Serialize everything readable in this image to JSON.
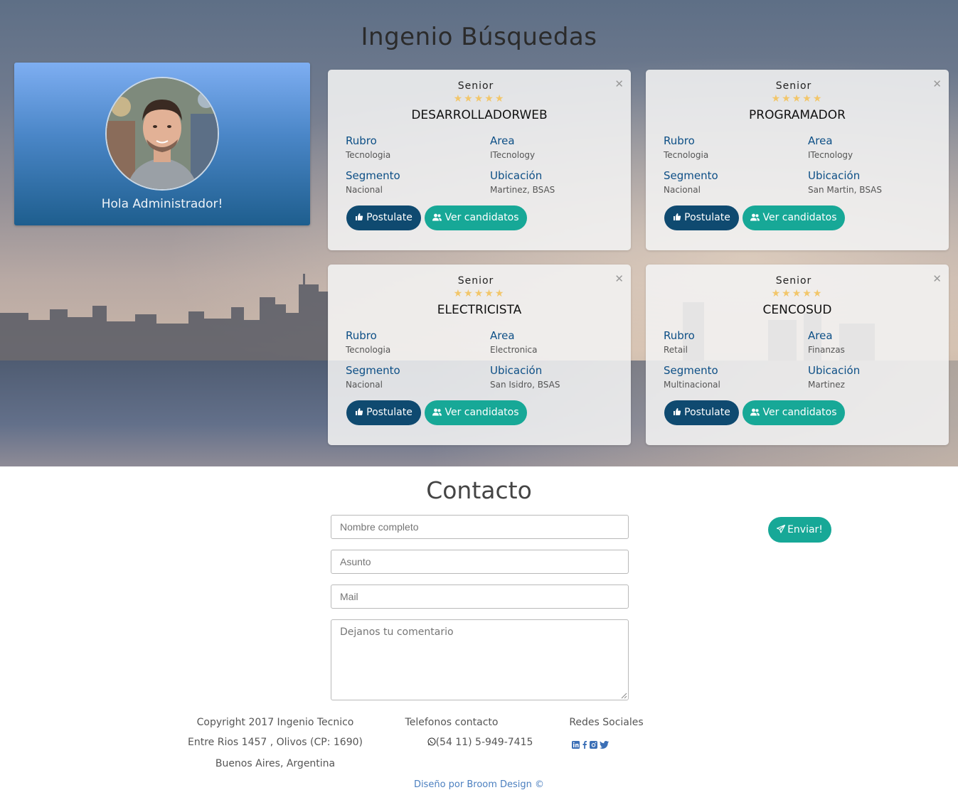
{
  "hero": {
    "title": "Ingenio Búsquedas"
  },
  "profile": {
    "greeting": "Hola Administrador!"
  },
  "jobs": [
    {
      "level": "Senior",
      "stars": "★★★★★",
      "title": "DESARROLLADORWEB",
      "rubro_label": "Rubro",
      "rubro": "Tecnologia",
      "area_label": "Area",
      "area": "ITecnology",
      "segmento_label": "Segmento",
      "segmento": "Nacional",
      "ubicacion_label": "Ubicación",
      "ubicacion": "Martinez, BSAS",
      "postulate": "Postulate",
      "candidatos": "Ver candidatos"
    },
    {
      "level": "Senior",
      "stars": "★★★★★",
      "title": "PROGRAMADOR",
      "rubro_label": "Rubro",
      "rubro": "Tecnologia",
      "area_label": "Area",
      "area": "ITecnology",
      "segmento_label": "Segmento",
      "segmento": "Nacional",
      "ubicacion_label": "Ubicación",
      "ubicacion": "San Martin, BSAS",
      "postulate": "Postulate",
      "candidatos": "Ver candidatos"
    },
    {
      "level": "Senior",
      "stars": "★★★★★",
      "title": "ELECTRICISTA",
      "rubro_label": "Rubro",
      "rubro": "Tecnologia",
      "area_label": "Area",
      "area": "Electronica",
      "segmento_label": "Segmento",
      "segmento": "Nacional",
      "ubicacion_label": "Ubicación",
      "ubicacion": "San Isidro, BSAS",
      "postulate": "Postulate",
      "candidatos": "Ver candidatos"
    },
    {
      "level": "Senior",
      "stars": "★★★★★",
      "title": "CENCOSUD",
      "rubro_label": "Rubro",
      "rubro": "Retail",
      "area_label": "Area",
      "area": "Finanzas",
      "segmento_label": "Segmento",
      "segmento": "Multinacional",
      "ubicacion_label": "Ubicación",
      "ubicacion": "Martinez",
      "postulate": "Postulate",
      "candidatos": "Ver candidatos"
    }
  ],
  "contact": {
    "title": "Contacto",
    "name_placeholder": "Nombre completo",
    "subject_placeholder": "Asunto",
    "mail_placeholder": "Mail",
    "comment_placeholder": "Dejanos tu comentario",
    "send_label": "Enviar!"
  },
  "footer": {
    "copyright": "Copyright 2017 Ingenio Tecnico",
    "address": "Entre Rios 1457 , Olivos (CP: 1690)",
    "city": "Buenos Aires, Argentina",
    "phones_title": "Telefonos contacto",
    "phone": "(54 11) 5-949-7415",
    "social_title": "Redes Sociales",
    "social_icons": [
      "linkedin-icon",
      "facebook-icon",
      "instagram-icon",
      "twitter-icon"
    ],
    "credit": "Diseño por Broom Design ©"
  },
  "colors": {
    "primary_button": "#0f4a70",
    "accent_button": "#17a897",
    "label_blue": "#0d4f86",
    "star": "#f2c66a"
  }
}
